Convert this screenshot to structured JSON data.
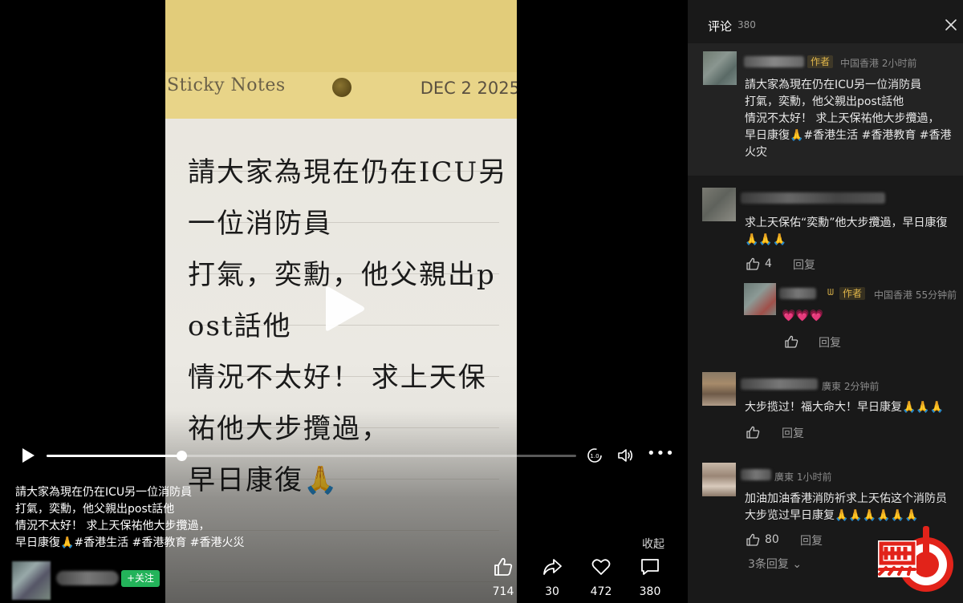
{
  "video": {
    "note_brand": "Sticky Notes",
    "note_date": "DEC 2 2025",
    "note_text": "請大家為現在仍在ICU另\n一位消防員\n打氣，奕勳，他父親出p\nost話他\n情況不太好！ 求上天保\n祐他大步攬過，\n早日康復🙏",
    "progress_fraction": 0.255,
    "caption": "請大家為現在仍在ICU另一位消防員\n打氣，奕勳，他父親出post話他\n情況不太好！ 求上天保祐他大步攬過，\n早日康復🙏#香港生活 #香港教育 #香港火災",
    "collapse_label": "收起",
    "follow_label": "+关注",
    "speed_label": "1.0"
  },
  "actions": {
    "likes": "714",
    "shares": "30",
    "favorites": "472",
    "comments": "380"
  },
  "comments_panel": {
    "title": "评论",
    "total": "380",
    "items": [
      {
        "author_tag": "作者",
        "meta": "中国香港 2小时前",
        "text": "請大家為現在仍在ICU另一位消防員\n打氣，奕勳，他父親出post話他\n情況不太好！ 求上天保祐他大步攬過，\n早日康復🙏#香港生活 #香港教育 #香港\n火灾"
      },
      {
        "text": "求上天保佑“奕勳”他大步攬過，早日康復\n🙏🙏🙏",
        "likes": "4",
        "reply_label": "回复",
        "reply": {
          "author_tag": "作者",
          "meta": "中国香港 55分钟前",
          "text": "💗💗💗",
          "reply_label": "回复"
        }
      },
      {
        "meta": "廣東 2分钟前",
        "text": "大步揽过！福大命大！早日康复🙏🙏🙏",
        "reply_label": "回复"
      },
      {
        "meta": "廣東 1小时前",
        "text": "加油加油香港消防祈求上天佑这个消防员\n大步览过早日康复🙏🙏🙏🙏🙏🙏",
        "likes": "80",
        "reply_label": "回复",
        "expand_label": "3条回复 ⌄"
      }
    ]
  },
  "colors": {
    "follow_green": "#23b35a",
    "author_tag": "#e0b64a",
    "panel_bg": "#191919",
    "logo_red": "#e2231a"
  }
}
